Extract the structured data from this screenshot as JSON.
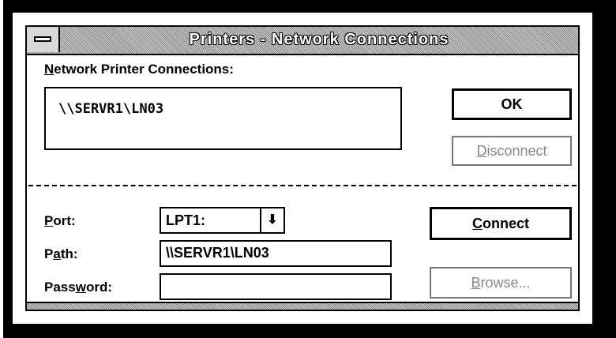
{
  "window": {
    "title": "Printers - Network Connections"
  },
  "connections": {
    "label_pre": "",
    "label_hotkey": "N",
    "label_post": "etwork Printer Connections:",
    "items": [
      "\\\\SERVR1\\LN03"
    ]
  },
  "buttons": {
    "ok": "OK",
    "disconnect_hotkey": "D",
    "disconnect_rest": "isconnect",
    "connect_hotkey": "C",
    "connect_rest": "onnect",
    "browse_hotkey": "B",
    "browse_rest": "rowse..."
  },
  "port": {
    "label_hotkey": "P",
    "label_rest": "ort:",
    "value": "LPT1:"
  },
  "path": {
    "label_pre": "P",
    "label_hotkey": "a",
    "label_post": "th:",
    "value": "\\\\SERVR1\\LN03"
  },
  "password": {
    "label_pre": "Pass",
    "label_hotkey": "w",
    "label_post": "ord:",
    "value": ""
  },
  "icons": {
    "system_menu": "system-menu-icon",
    "dropdown": "down-arrow-icon"
  }
}
